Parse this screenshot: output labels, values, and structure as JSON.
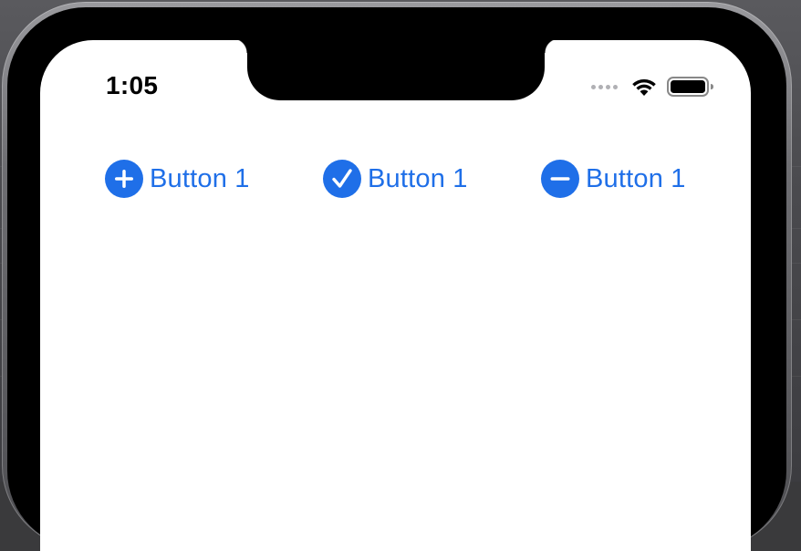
{
  "status_bar": {
    "time": "1:05",
    "signal_icon": "signal-dots-icon",
    "wifi_icon": "wifi-icon",
    "battery_icon": "battery-icon"
  },
  "buttons": [
    {
      "label": "Button 1",
      "icon": "plus-circle-icon"
    },
    {
      "label": "Button 1",
      "icon": "checkmark-circle-icon"
    },
    {
      "label": "Button 1",
      "icon": "minus-circle-icon"
    }
  ],
  "colors": {
    "accent": "#1f6fe8",
    "screen_background": "#ffffff",
    "device_bezel": "#000000"
  }
}
